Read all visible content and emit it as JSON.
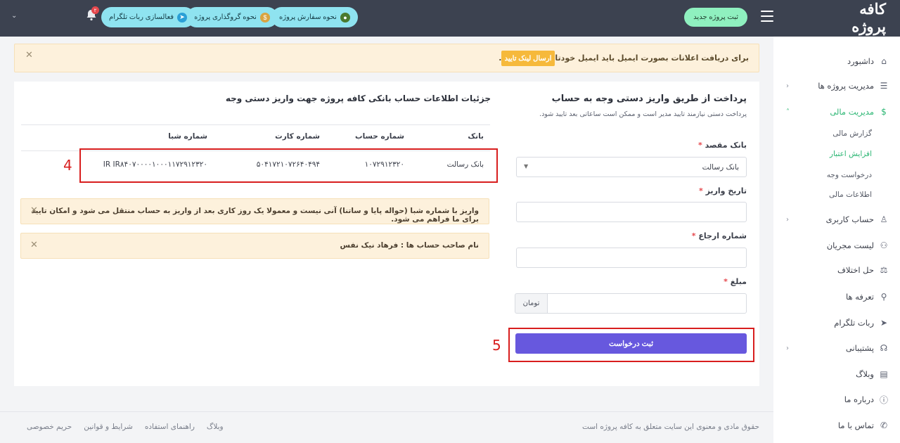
{
  "header": {
    "brand": "کافه پروژه",
    "new_project": "ثبت پروژه جدید",
    "pills": [
      {
        "label": "نحوه سفارش پروژه",
        "icon": "guide-icon"
      },
      {
        "label": "نحوه گروگذاری پروژه",
        "icon": "money-bag-icon"
      },
      {
        "label": "فعالسازی ربات تلگرام",
        "icon": "telegram-icon"
      }
    ],
    "notification_count": "۲"
  },
  "sidebar": {
    "items": [
      {
        "label": "داشبورد",
        "icon": "home-icon"
      },
      {
        "label": "مدیریت پروژه ها",
        "icon": "list-icon"
      },
      {
        "label": "مدیریت مالی",
        "icon": "dollar-icon"
      },
      {
        "label": "حساب کاربری",
        "icon": "user-icon"
      },
      {
        "label": "لیست مجریان",
        "icon": "users-icon"
      },
      {
        "label": "حل اختلاف",
        "icon": "scale-icon"
      },
      {
        "label": "تعرفه ها",
        "icon": "tag-icon"
      },
      {
        "label": "ربات تلگرام",
        "icon": "telegram-icon"
      },
      {
        "label": "پشتیبانی",
        "icon": "headset-icon"
      },
      {
        "label": "وبلاگ",
        "icon": "blog-icon"
      },
      {
        "label": "درباره ما",
        "icon": "info-icon"
      },
      {
        "label": "تماس با ما",
        "icon": "phone-icon"
      }
    ],
    "finance_sub": [
      "گزارش مالی",
      "افزایش اعتبار",
      "درخواست وجه",
      "اطلاعات مالی"
    ]
  },
  "email_alert": {
    "message": "برای دریافت اعلانات بصورت ایمیل باید ایمیل خودتان را تایید کنید.",
    "button": "ارسال لینک تایید"
  },
  "form": {
    "title": "پرداخت از طریق واریز دستی وجه به حساب",
    "subtitle": "پرداخت دستی نیازمند تایید مدیر است و ممکن است ساعاتی بعد تایید شود.",
    "dest_bank_label": "بانک مقصد",
    "dest_bank_value": "بانک رسالت",
    "deposit_date_label": "تاریخ واریز",
    "reference_label": "شماره ارجاع",
    "amount_label": "مبلغ",
    "currency": "تومان",
    "submit": "ثبت درخواست",
    "required_mark": "*"
  },
  "bank_info": {
    "title": "جزئیات اطلاعات حساب بانکی کافه پروژه جهت واریز دستی وجه",
    "columns": [
      "بانک",
      "شماره حساب",
      "شماره کارت",
      "شماره شبا"
    ],
    "row": {
      "bank": "بانک رسالت",
      "account": "۱۰۷۲۹۱۲۳۲۰",
      "card": "۵۰۴۱۷۲۱۰۷۲۶۴۰۴۹۴",
      "sheba": "IR IR۸۴۰۷۰۰۰۰۱۰۰۰۱۱۷۲۹۱۲۳۲۰"
    },
    "sheba_note": "واریز با شماره شبا (حواله پایا و ساتنا) آنی نیست و معمولا یک روز کاری بعد از واریز به حساب منتقل می شود و امکان تایید برای ما فراهم می شود.",
    "owner_note": "نام صاحب حساب ها : فرهاد نیک نفس"
  },
  "annotations": {
    "box4": "4",
    "box5": "5"
  },
  "footer": {
    "copyright": "حقوق مادی و معنوی این سایت متعلق به کافه پروژه است",
    "links": [
      "وبلاگ",
      "راهنمای استفاده",
      "شرایط و قوانین",
      "حریم خصوصی"
    ]
  }
}
